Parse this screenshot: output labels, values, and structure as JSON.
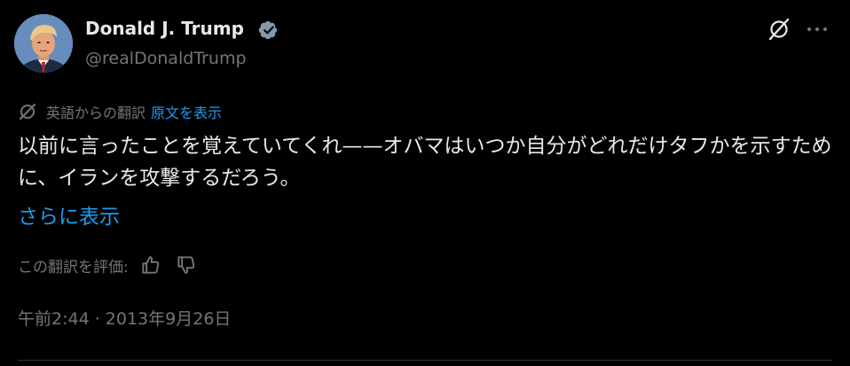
{
  "author": {
    "display_name": "Donald J. Trump",
    "handle": "@realDonaldTrump",
    "verified": true,
    "verified_badge_color": "#829aab",
    "avatar_icon": "profile-photo"
  },
  "header_actions": {
    "grok_icon": "grok-icon",
    "more_icon": "more-dots-icon"
  },
  "translation": {
    "icon": "translate-icon",
    "translated_from": "英語からの翻訳",
    "show_original_label": "原文を表示"
  },
  "post": {
    "text": "以前に言ったことを覚えていてくれ——オバマはいつか自分がどれだけタフかを示すために、イランを攻撃するだろう。",
    "show_more_label": "さらに表示"
  },
  "rating": {
    "label": "この翻訳を評価:",
    "thumbs_up_icon": "thumbs-up-icon",
    "thumbs_down_icon": "thumbs-down-icon"
  },
  "meta": {
    "timestamp": "午前2:44 · 2013年9月26日"
  },
  "colors": {
    "background": "#000000",
    "text_primary": "#e7e9ea",
    "text_secondary": "#71767b",
    "link": "#1d9bf0",
    "divider": "#2f3336"
  }
}
